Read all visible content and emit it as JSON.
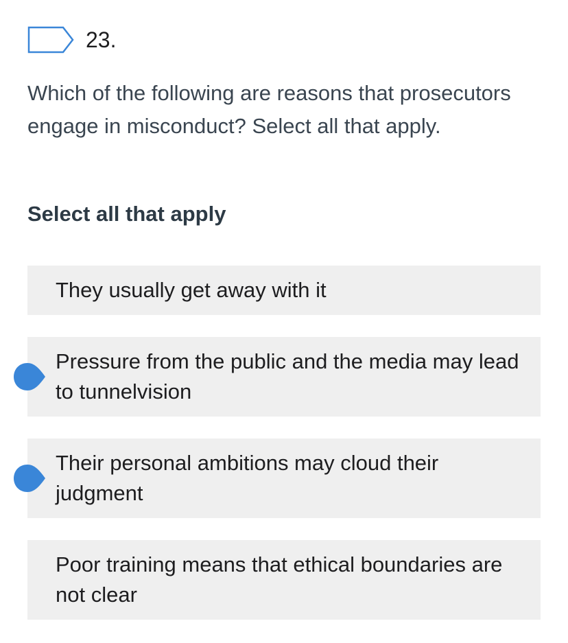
{
  "question": {
    "number": "23.",
    "text": "Which of the following are reasons that prosecutors engage in misconduct? Select all that apply.",
    "instruction": "Select all that apply"
  },
  "options": [
    {
      "label": "They usually get away with it",
      "selected": false
    },
    {
      "label": "Pressure from the public and the media may lead to tunnelvision",
      "selected": true
    },
    {
      "label": "Their personal ambitions may cloud their judgment",
      "selected": true
    },
    {
      "label": "Poor training means that ethical boundaries are not clear",
      "selected": false
    }
  ],
  "colors": {
    "accent": "#3a86d8",
    "option_bg": "#efefef",
    "text": "#1d1d1f"
  },
  "icons": {
    "flag": "flag-outline-icon",
    "selected": "selected-marker-icon"
  }
}
